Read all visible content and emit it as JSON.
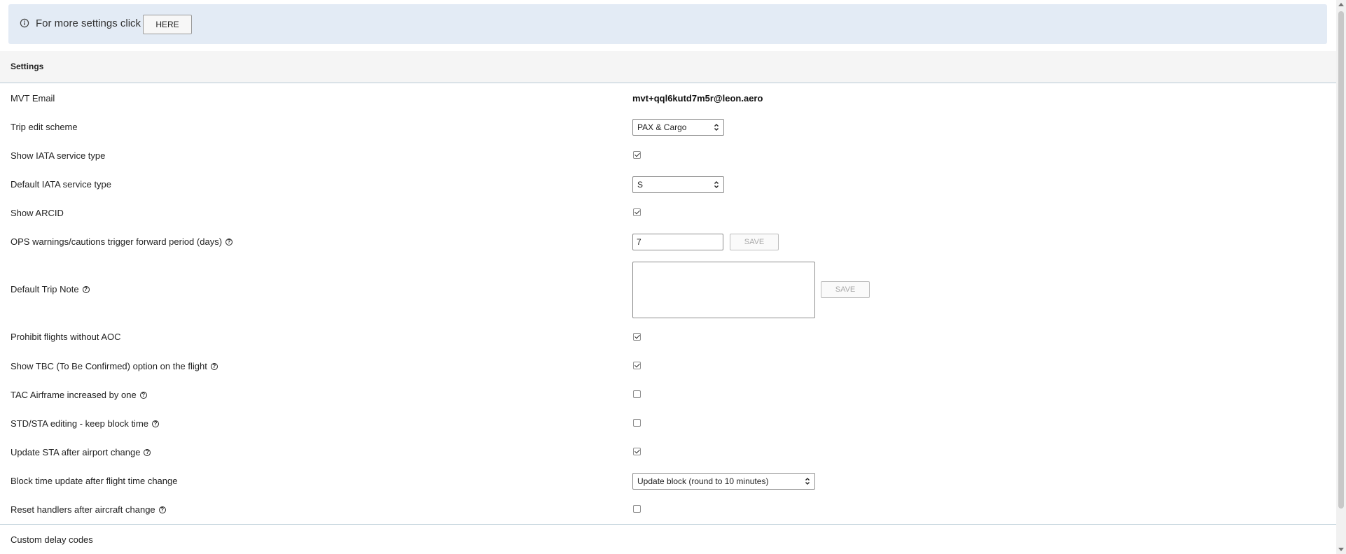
{
  "info": {
    "text": "For more settings click",
    "button": "HERE"
  },
  "settings": {
    "title": "Settings",
    "mvt_email": {
      "label": "MVT Email",
      "value": "mvt+qql6kutd7m5r@leon.aero"
    },
    "trip_edit_scheme": {
      "label": "Trip edit scheme",
      "value": "PAX & Cargo"
    },
    "show_iata_service_type": {
      "label": "Show IATA service type",
      "checked": true
    },
    "default_iata_service_type": {
      "label": "Default IATA service type",
      "value": "S"
    },
    "show_arcid": {
      "label": "Show ARCID",
      "checked": true
    },
    "ops_warnings": {
      "label": "OPS warnings/cautions trigger forward period (days)",
      "value": "7",
      "save": "SAVE"
    },
    "default_trip_note": {
      "label": "Default Trip Note",
      "value": "",
      "save": "SAVE"
    },
    "prohibit_flights": {
      "label": "Prohibit flights without AOC",
      "checked": true
    },
    "show_tbc": {
      "label": "Show TBC (To Be Confirmed) option on the flight",
      "checked": true
    },
    "tac_airframe": {
      "label": "TAC Airframe increased by one",
      "checked": false
    },
    "std_sta_editing": {
      "label": "STD/STA editing - keep block time",
      "checked": false
    },
    "update_sta": {
      "label": "Update STA after airport change",
      "checked": true
    },
    "block_time_update": {
      "label": "Block time update after flight time change",
      "value": "Update block (round to 10 minutes)"
    },
    "reset_handlers": {
      "label": "Reset handlers after aircraft change",
      "checked": false
    }
  },
  "custom_delay_codes": {
    "label": "Custom delay codes"
  },
  "icons": {
    "info": "info-circle-icon",
    "help": "question-circle-icon",
    "select": "chevron-up-down-icon"
  }
}
